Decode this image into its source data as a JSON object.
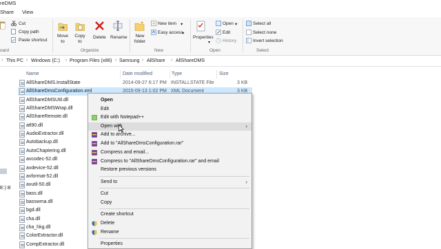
{
  "window": {
    "title": "reDMS"
  },
  "tabs": [
    {
      "label": "Share"
    },
    {
      "label": "View"
    }
  ],
  "ribbon": {
    "clipboard": {
      "cut": "Cut",
      "copy_path": "Copy path",
      "paste_shortcut": "Paste shortcut",
      "group": "oard"
    },
    "organize": {
      "move_to": "Move to",
      "copy_to": "Copy to",
      "delete": "Delete",
      "rename": "Rename",
      "group": "Organize"
    },
    "new": {
      "new_folder": "New folder",
      "new_item": "New item",
      "easy_access": "Easy access",
      "group": "New"
    },
    "open": {
      "properties": "Properties",
      "open": "Open",
      "edit": "Edit",
      "history": "History",
      "group": "Open"
    },
    "select": {
      "select_all": "Select all",
      "select_none": "Select none",
      "invert": "Invert selection",
      "group": "Select"
    }
  },
  "address": {
    "crumbs": [
      "This PC",
      "Windows (C:)",
      "Program Files (x86)",
      "Samsung",
      "AllShare",
      "AllShareDMS"
    ]
  },
  "columns": {
    "name": "Name",
    "date": "Date modified",
    "type": "Type",
    "size": "Size"
  },
  "files": [
    {
      "name": "AllShareDMS.InstallState",
      "date": "2014-09-27 6:17 PM",
      "type": "INSTALLSTATE File",
      "size": "3 KB"
    },
    {
      "name": "AllShareDmsConfiguration.xml",
      "date": "2015-09-13 1:02 PM",
      "type": "XML Document",
      "size": "3 KB"
    },
    {
      "name": "AllShareDMSUtil.dll"
    },
    {
      "name": "AllShareDMSWrap.dll"
    },
    {
      "name": "AllShareRemote.dll"
    },
    {
      "name": "atl90.dll"
    },
    {
      "name": "AudioExtractor.dll"
    },
    {
      "name": "Autobackup.dll"
    },
    {
      "name": "AutoChaptering.dll"
    },
    {
      "name": "avcodec-52.dll"
    },
    {
      "name": "avdevice-52.dll"
    },
    {
      "name": "avformat-52.dll"
    },
    {
      "name": "avutil-50.dll"
    },
    {
      "name": "bass.dll"
    },
    {
      "name": "basswma.dll"
    },
    {
      "name": "bgd.dll"
    },
    {
      "name": "cha.dll"
    },
    {
      "name": "cha_hkg.dll"
    },
    {
      "name": "ColorExtractor.dll"
    },
    {
      "name": "CompExtractor.dll"
    }
  ],
  "nav": {
    "drive_label": "E:) B"
  },
  "context_menu": {
    "items": [
      {
        "label": "Open"
      },
      {
        "label": "Edit"
      },
      {
        "label": "Edit with Notepad++"
      },
      {
        "label": "Open with"
      },
      {
        "label": "Add to archive..."
      },
      {
        "label": "Add to \"AllShareDmsConfiguration.rar\""
      },
      {
        "label": "Compress and email..."
      },
      {
        "label": "Compress to \"AllShareDmsConfiguration.rar\" and email"
      },
      {
        "label": "Restore previous versions"
      },
      {
        "label": "Send to"
      },
      {
        "label": "Cut"
      },
      {
        "label": "Copy"
      },
      {
        "label": "Create shortcut"
      },
      {
        "label": "Delete"
      },
      {
        "label": "Rename"
      },
      {
        "label": "Properties"
      }
    ]
  }
}
